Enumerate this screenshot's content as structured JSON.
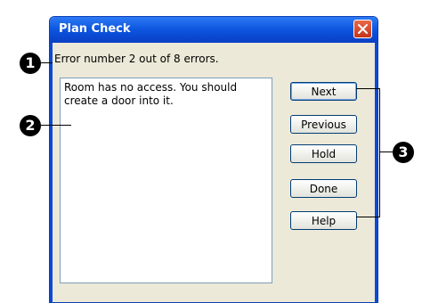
{
  "window": {
    "title": "Plan Check",
    "close_icon": "close-icon"
  },
  "status": {
    "error_text": "Error number 2 out of 8 errors."
  },
  "message": {
    "text": "Room has no access. You should create a door into it."
  },
  "buttons": {
    "next": "Next",
    "previous": "Previous",
    "hold": "Hold",
    "done": "Done",
    "help": "Help"
  },
  "callouts": {
    "one": "1",
    "two": "2",
    "three": "3"
  },
  "colors": {
    "titlebar": "#0a4ad4",
    "dialog_bg": "#ece9d8",
    "close_button": "#d4452a"
  }
}
